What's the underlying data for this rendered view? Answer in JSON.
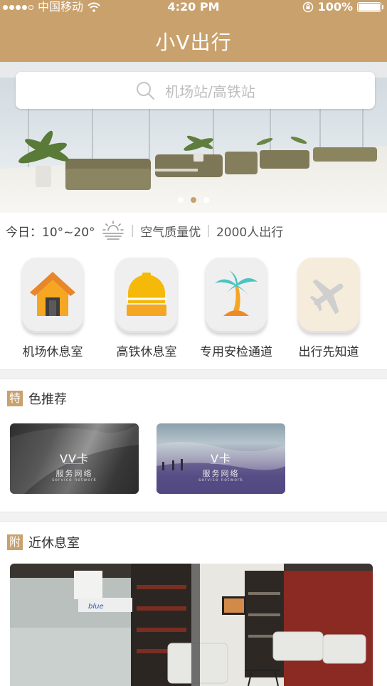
{
  "status_bar": {
    "carrier": "中国移动",
    "time": "4:20 PM",
    "battery": "100%"
  },
  "nav": {
    "title": "小V出行"
  },
  "search": {
    "placeholder": "机场站/高铁站"
  },
  "banner": {
    "page_count": 3,
    "active_page": 2
  },
  "info": {
    "temp_label": "今日：10°~20°",
    "air_quality": "空气质量优",
    "travelers": "2000人出行"
  },
  "services": [
    {
      "label": "机场休息室",
      "icon": "house-icon"
    },
    {
      "label": "高铁休息室",
      "icon": "train-icon"
    },
    {
      "label": "专用安检通道",
      "icon": "palm-tree-icon"
    },
    {
      "label": "出行先知道",
      "icon": "airplane-icon"
    }
  ],
  "featured": {
    "badge": "特",
    "title": "色推荐",
    "cards": [
      {
        "name": "VV卡",
        "subtitle": "服务网络",
        "en": "service network"
      },
      {
        "name": "V卡",
        "subtitle": "服务网络",
        "en": "service network"
      }
    ]
  },
  "nearby": {
    "badge": "附",
    "title": "近休息室",
    "photo_sign": "blue"
  },
  "colors": {
    "brand": "#c9a16d",
    "accent_orange": "#f5a623",
    "divider": "#f2f2f2"
  }
}
